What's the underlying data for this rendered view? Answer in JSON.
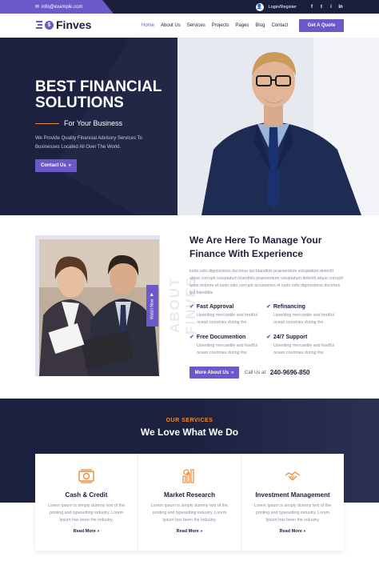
{
  "colors": {
    "accent": "#6b58c9",
    "navy": "#1c2140",
    "orange": "#f08a34"
  },
  "topbar": {
    "email": "info@example.com",
    "login": "Login/Register",
    "social": [
      "f",
      "t",
      "i",
      "in"
    ]
  },
  "nav": {
    "brand": "Finves",
    "items": [
      "Home",
      "About Us",
      "Services",
      "Projects",
      "Pages",
      "Blog",
      "Contact"
    ],
    "active": "Home",
    "quote_button": "Get A Quote"
  },
  "hero": {
    "title_line1": "BEST FINANCIAL",
    "title_line2": "SOLUTIONS",
    "subtitle": "For Your Business",
    "description_line1": "We Provide Quality Financial Advisory Services To",
    "description_line2": "Businesses Located All Over The World.",
    "button": "Contact Us"
  },
  "about": {
    "watch_label": "Watch Now",
    "vertical_text": "ABOUT FINVES",
    "heading_line1": "We Are Here To Manage Your",
    "heading_line2": "Finance With Experience",
    "paragraph": "iusto odio dignissimos ducimus qui blanditiis praesentium voluptatum deleniti atque corrupti voluptatum blanditiis praesentium voluptatum deleniti atque corrupti quos dolores et iusto odio corrupti accusamus et iusto odio dignissimos ducimus qui blanditiis",
    "features": [
      {
        "title": "Fast Approval",
        "desc_line1": "Upsetting mercantile and foodful",
        "desc_line2": "ocean countries during the."
      },
      {
        "title": "Refinancing",
        "desc_line1": "Upsetting mercantile and foodful",
        "desc_line2": "ocean countries during the."
      },
      {
        "title": "Free Documention",
        "desc_line1": "Upsetting mercantile and foodful",
        "desc_line2": "ocean countries during the."
      },
      {
        "title": "24/7 Support",
        "desc_line1": "Upsetting mercantile and foodful",
        "desc_line2": "ocean countries during the."
      }
    ],
    "button": "More About Us",
    "call_label": "Call Us at:",
    "phone": "240-9696-850"
  },
  "services": {
    "eyebrow": "OUR SERVICES",
    "heading": "We Love What We Do",
    "cards": [
      {
        "icon": "money-icon",
        "title": "Cash & Credit",
        "desc_line1": "Lorem Ipsum is simply dummy text of the",
        "desc_line2": "printing and typesetting industry. Lorem",
        "desc_line3": "Ipsum has been the industry.",
        "link": "Read More"
      },
      {
        "icon": "chart-search-icon",
        "title": "Market Research",
        "desc_line1": "Lorem Ipsum is simply dummy text of the",
        "desc_line2": "printing and typesetting industry. Lorem",
        "desc_line3": "Ipsum has been the industry.",
        "link": "Read More"
      },
      {
        "icon": "handshake-icon",
        "title": "Investment Management",
        "desc_line1": "Lorem Ipsum is simply dummy text of the",
        "desc_line2": "printing and typesetting industry. Lorem",
        "desc_line3": "Ipsum has been the industry.",
        "link": "Read More"
      }
    ]
  }
}
